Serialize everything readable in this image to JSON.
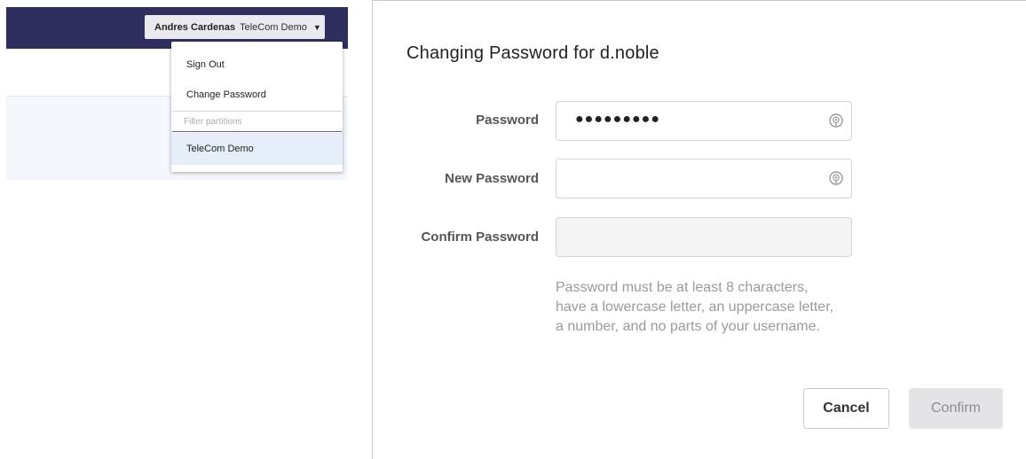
{
  "header": {
    "user_name": "Andres Cardenas",
    "partition_name": "TeleCom Demo",
    "caret": "▼"
  },
  "user_menu": {
    "sign_out": "Sign Out",
    "change_password": "Change Password",
    "filter_placeholder": "Filter partitions",
    "partitions": [
      "TeleCom Demo"
    ]
  },
  "dialog": {
    "title": "Changing Password for d.noble",
    "password_label": "Password",
    "password_value_masked": "●●●●●●●●●",
    "new_password_label": "New Password",
    "confirm_password_label": "Confirm Password",
    "hint": "Password must be at least 8 characters, have a lowercase letter, an uppercase letter, a number, and no parts of your username.",
    "cancel_label": "Cancel",
    "confirm_label": "Confirm",
    "icons": [
      "eye-icon"
    ]
  },
  "colors": {
    "topbar": "#2e2f5e",
    "selected_item": "#e6eef9",
    "content_bg": "#f4f7fc",
    "hint_text": "#9a9a9a"
  }
}
